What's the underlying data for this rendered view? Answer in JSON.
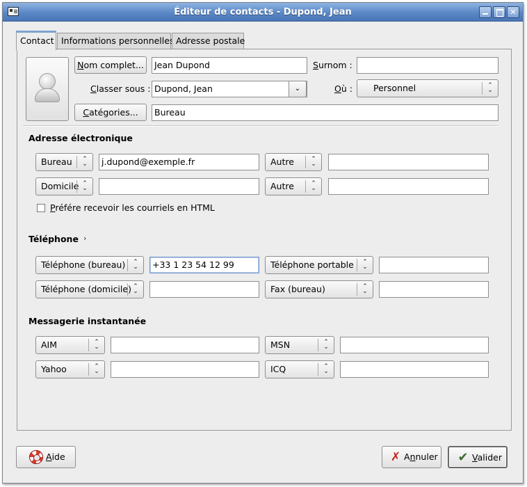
{
  "window": {
    "title": "Éditeur de contacts - Dupond, Jean"
  },
  "tabs": [
    {
      "label": "Contact",
      "active": true
    },
    {
      "label": "Informations personnelles",
      "active": false
    },
    {
      "label": "Adresse postale",
      "active": false
    }
  ],
  "identity": {
    "full_name_button": {
      "u": "N",
      "rest": "om complet..."
    },
    "full_name_value": "Jean Dupond",
    "nickname_label": {
      "u": "S",
      "rest": "urnom :"
    },
    "nickname_value": "",
    "file_under_label": {
      "u": "C",
      "rest": "lasser sous :"
    },
    "file_under_value": "Dupond, Jean",
    "where_label": {
      "u": "O",
      "rest": "ù :"
    },
    "where_value": "Personnel",
    "categories_button": {
      "u": "C",
      "rest": "atégories..."
    },
    "categories_value": "Bureau"
  },
  "email": {
    "heading": "Adresse électronique",
    "rows": [
      {
        "type1": "Bureau",
        "value1": "j.dupond@exemple.fr",
        "type2": "Autre",
        "value2": ""
      },
      {
        "type1": "Domicile",
        "value1": "",
        "type2": "Autre",
        "value2": ""
      }
    ],
    "html_pref": {
      "u": "P",
      "rest": "référe recevoir les courriels en HTML",
      "checked": false
    }
  },
  "phone": {
    "heading": "Téléphone",
    "expander": "›",
    "rows": [
      {
        "type1": "Téléphone (bureau)",
        "value1": "+33 1 23 54 12 99",
        "type2": "Téléphone portable",
        "value2": ""
      },
      {
        "type1": "Téléphone (domicile)",
        "value1": "",
        "type2": "Fax (bureau)",
        "value2": ""
      }
    ]
  },
  "im": {
    "heading": "Messagerie instantanée",
    "rows": [
      {
        "type1": "AIM",
        "value1": "",
        "type2": "MSN",
        "value2": ""
      },
      {
        "type1": "Yahoo",
        "value1": "",
        "type2": "ICQ",
        "value2": ""
      }
    ]
  },
  "footer": {
    "help": {
      "u": "A",
      "rest": "ide"
    },
    "cancel": {
      "pre": "A",
      "u": "n",
      "rest": "nuler"
    },
    "ok": {
      "u": "V",
      "rest": "alider"
    }
  },
  "icons": {
    "app": "address-book-icon",
    "contact_photo": "contact-photo-placeholder-icon",
    "help": "lifebuoy-icon",
    "cancel": "red-x-icon",
    "ok": "checkmark-icon"
  },
  "colors": {
    "titlebar": "#5a87c5",
    "title_text": "#ffffff",
    "background": "#ededed",
    "tab_active_accent": "#7da2ce",
    "focus_border": "#6f95c8"
  }
}
